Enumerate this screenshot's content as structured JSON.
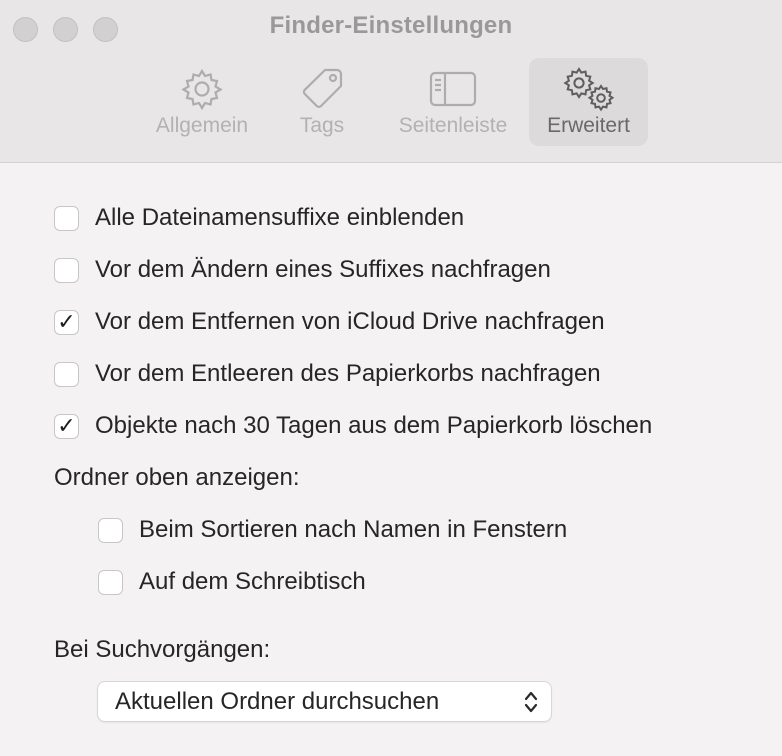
{
  "window": {
    "title": "Finder-Einstellungen",
    "traffic_lights": [
      "close",
      "minimize",
      "zoom"
    ]
  },
  "tabs": [
    {
      "label": "Allgemein",
      "icon": "gear-icon",
      "active": false
    },
    {
      "label": "Tags",
      "icon": "tag-icon",
      "active": false
    },
    {
      "label": "Seitenleiste",
      "icon": "sidebar-icon",
      "active": false
    },
    {
      "label": "Erweitert",
      "icon": "gears-icon",
      "active": true
    }
  ],
  "options": [
    {
      "label": "Alle Dateinamensuffixe einblenden",
      "checked": false
    },
    {
      "label": "Vor dem Ändern eines Suffixes nachfragen",
      "checked": false
    },
    {
      "label": "Vor dem Entfernen von iCloud Drive nachfragen",
      "checked": true
    },
    {
      "label": "Vor dem Entleeren des Papierkorbs nachfragen",
      "checked": false
    },
    {
      "label": "Objekte nach 30 Tagen aus dem Papierkorb löschen",
      "checked": true
    }
  ],
  "folders_on_top": {
    "heading": "Ordner oben anzeigen:",
    "options": [
      {
        "label": "Beim Sortieren nach Namen in Fenstern",
        "checked": false
      },
      {
        "label": "Auf dem Schreibtisch",
        "checked": false
      }
    ]
  },
  "search": {
    "heading": "Bei Suchvorgängen:",
    "selected": "Aktuellen Ordner durchsuchen"
  },
  "colors": {
    "titlebar": "#e8e6e6",
    "content_bg": "#f4f2f2",
    "active_tab": "#dcdada",
    "checkmark": "#1d1d1d"
  }
}
